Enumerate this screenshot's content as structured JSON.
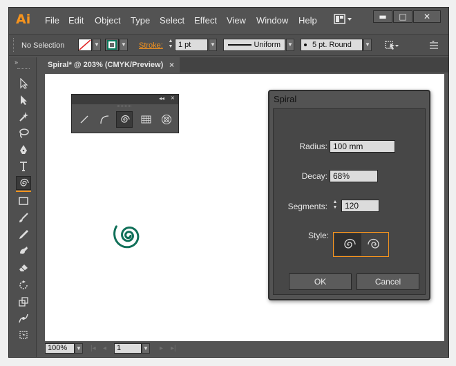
{
  "app": {
    "logo": "Ai"
  },
  "menu": [
    "File",
    "Edit",
    "Object",
    "Type",
    "Select",
    "Effect",
    "View",
    "Window",
    "Help"
  ],
  "window_controls": {
    "minimize": "▬",
    "maximize": "□",
    "close": "✕"
  },
  "control_bar": {
    "selection_status": "No Selection",
    "stroke_label": "Stroke:",
    "stroke_weight": "1 pt",
    "stroke_profile": "Uniform",
    "brush": "5 pt. Round"
  },
  "document_tab": {
    "title": "Spiral* @ 203% (CMYK/Preview)",
    "close": "×"
  },
  "status_bar": {
    "zoom": "100%",
    "artboard": "1"
  },
  "spiral_dialog": {
    "title": "Spiral",
    "radius_label": "Radius:",
    "radius_value": "100 mm",
    "decay_label": "Decay:",
    "decay_value": "68%",
    "segments_label": "Segments:",
    "segments_value": "120",
    "style_label": "Style:",
    "ok_label": "OK",
    "cancel_label": "Cancel"
  },
  "colors": {
    "spiral_stroke": "#117059",
    "accent_orange": "#f7941d",
    "ui_dark": "#535353"
  }
}
